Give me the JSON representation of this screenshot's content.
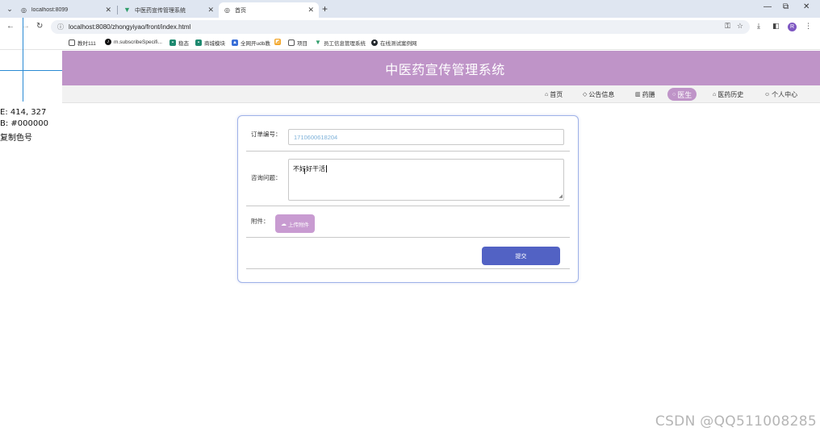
{
  "browser": {
    "tabs": [
      {
        "title": "localhost:8099",
        "icon": "globe-icon",
        "active": false
      },
      {
        "title": "中医药宣传管理系统",
        "icon": "vue-icon",
        "active": false
      },
      {
        "title": "首页",
        "icon": "globe-icon",
        "active": true
      }
    ],
    "new_tab": "+",
    "url": "localhost:8080/zhongyiyao/front/index.html",
    "profile_initial": "R",
    "bookmarks": [
      {
        "label": "教时111",
        "icon": "folder-icon"
      },
      {
        "label": "m.subscribeSpecifi...",
        "icon": "tiktok-icon"
      },
      {
        "label": "稳态",
        "icon": "app-icon"
      },
      {
        "label": "商城模块",
        "icon": "app-icon"
      },
      {
        "label": "全网开udb教",
        "icon": "app-icon"
      },
      {
        "label": "",
        "icon": "app-icon"
      },
      {
        "label": "项目",
        "icon": "folder-icon"
      },
      {
        "label": "员工信息管理系统",
        "icon": "vue-icon"
      },
      {
        "label": "在线测试案例网",
        "icon": "github-icon"
      }
    ]
  },
  "overlay": {
    "coords_label": "E: 414, 327",
    "color_label": "B: #000000",
    "copy_label": "复制色号"
  },
  "site": {
    "title": "中医药宣传管理系统",
    "nav": [
      {
        "label": "首页",
        "icon": "home-icon",
        "active": false
      },
      {
        "label": "公告信息",
        "icon": "tag-icon",
        "active": false
      },
      {
        "label": "药膳",
        "icon": "gift-icon",
        "active": false
      },
      {
        "label": "医生",
        "icon": "circle-icon",
        "active": true
      },
      {
        "label": "医药历史",
        "icon": "bank-icon",
        "active": false
      },
      {
        "label": "个人中心",
        "icon": "user-icon",
        "active": false
      }
    ]
  },
  "form": {
    "order_label": "订单编号：",
    "order_value": "1710600618204",
    "question_label": "咨询问题：",
    "question_value": "不好好干活",
    "attachment_label": "附件：",
    "upload_label": "上传附件",
    "submit_label": "提交"
  },
  "watermark": "CSDN @QQ511008285",
  "colors": {
    "header": "#bf94c8",
    "upload_button": "#c89bd1",
    "submit_button": "#5262c4",
    "card_border": "#9fb2e8"
  }
}
